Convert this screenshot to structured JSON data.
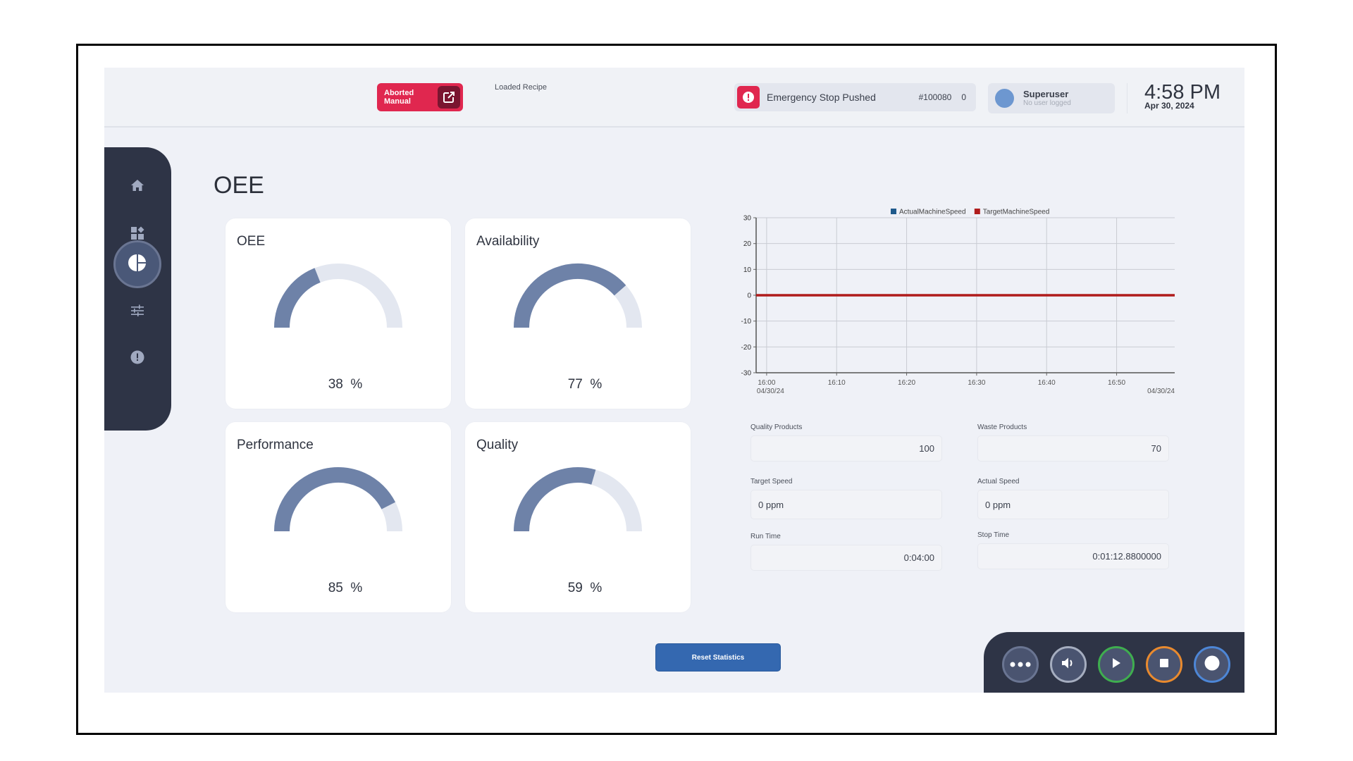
{
  "header": {
    "mode_badge": {
      "line1": "Aborted",
      "line2": "Manual",
      "icon": "external-link-icon"
    },
    "loaded_recipe_label": "Loaded Recipe",
    "alarm": {
      "icon": "alert-icon",
      "text": "Emergency Stop Pushed",
      "id": "#100080",
      "count": "0"
    },
    "user": {
      "name": "Superuser",
      "status": "No user logged"
    },
    "clock": {
      "time": "4:58 PM",
      "date": "Apr 30, 2024"
    }
  },
  "sidebar": {
    "items": [
      {
        "name": "home",
        "icon": "home-icon",
        "active": false
      },
      {
        "name": "dashboard",
        "icon": "widgets-icon",
        "active": false
      },
      {
        "name": "oee",
        "icon": "pie-chart-icon",
        "active": true
      },
      {
        "name": "settings",
        "icon": "sliders-icon",
        "active": false
      },
      {
        "name": "alarms",
        "icon": "alert-icon",
        "active": false
      }
    ]
  },
  "page": {
    "title": "OEE"
  },
  "gauges": [
    {
      "label": "OEE",
      "value": 38,
      "unit": "%"
    },
    {
      "label": "Availability",
      "value": 77,
      "unit": "%"
    },
    {
      "label": "Performance",
      "value": 85,
      "unit": "%"
    },
    {
      "label": "Quality",
      "value": 59,
      "unit": "%"
    }
  ],
  "colors": {
    "gauge_fill": "#6e82a8",
    "gauge_track": "#e3e7f0",
    "actual_series": "#1f5a8c",
    "target_series": "#b01c1c",
    "accent_red": "#e0274f",
    "primary_blue": "#3468b0"
  },
  "chart_data": {
    "type": "line",
    "title": "",
    "xlabel": "",
    "ylabel": "",
    "ylim": [
      -30,
      30
    ],
    "yticks": [
      30,
      20,
      10,
      0,
      -10,
      -20,
      -30
    ],
    "xlim_minutes": [
      -1.5,
      58.3
    ],
    "xticks": [
      {
        "minute": 0,
        "label": "16:00",
        "sublabel": "04/30/24"
      },
      {
        "minute": 10,
        "label": "16:10"
      },
      {
        "minute": 20,
        "label": "16:20"
      },
      {
        "minute": 30,
        "label": "16:30"
      },
      {
        "minute": 40,
        "label": "16:40"
      },
      {
        "minute": 50,
        "label": "16:50"
      }
    ],
    "x_end_label": "04/30/24",
    "grid": true,
    "legend": {
      "placement": "top-center",
      "entries": [
        "ActualMachineSpeed",
        "TargetMachineSpeed"
      ]
    },
    "series": [
      {
        "name": "ActualMachineSpeed",
        "x_minutes": [
          -1.5,
          58.3
        ],
        "values": [
          0,
          0
        ]
      },
      {
        "name": "TargetMachineSpeed",
        "x_minutes": [
          -1.5,
          58.3
        ],
        "values": [
          0,
          0
        ]
      }
    ]
  },
  "stats": {
    "quality_products": {
      "label": "Quality Products",
      "value": "100"
    },
    "waste_products": {
      "label": "Waste Products",
      "value": "70"
    },
    "target_speed": {
      "label": "Target Speed",
      "value": "0 ppm"
    },
    "actual_speed": {
      "label": "Actual Speed",
      "value": "0 ppm"
    },
    "run_time": {
      "label": "Run Time",
      "value": "0:04:00"
    },
    "stop_time": {
      "label": "Stop Time",
      "value": "0:01:12.8800000"
    }
  },
  "reset_button": {
    "label": "Reset Statistics"
  },
  "controls": [
    {
      "name": "more",
      "icon": "more-icon",
      "ring": "#6a7592"
    },
    {
      "name": "sound",
      "icon": "speaker-icon",
      "ring": "#a5adbf"
    },
    {
      "name": "start",
      "icon": "play-icon",
      "ring": "#3fae4f"
    },
    {
      "name": "stop",
      "icon": "stop-icon",
      "ring": "#e98a2e"
    },
    {
      "name": "record",
      "icon": "record-icon",
      "ring": "#4d86d6"
    }
  ]
}
